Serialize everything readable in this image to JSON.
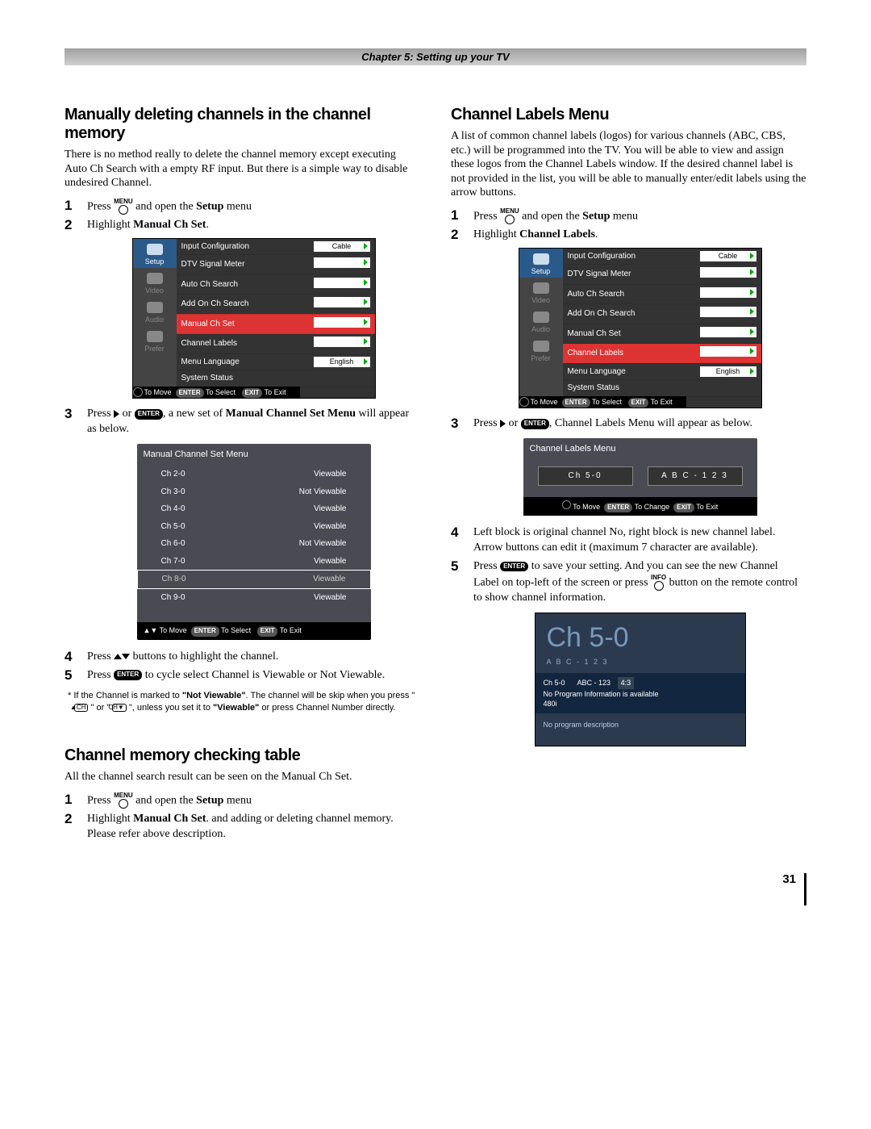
{
  "chapter_bar": "Chapter 5: Setting up your TV",
  "page_number": "31",
  "left": {
    "h1": "Manually deleting channels in the channel memory",
    "intro": "There is no method really to delete the channel memory except executing Auto Ch Search with a empty RF input. But there is a simple way to disable undesired Channel.",
    "step1_a": "Press ",
    "step1_menu": "MENU",
    "step1_b": " and open the ",
    "step1_bold": "Setup",
    "step1_c": " menu",
    "step2_a": "Highlight ",
    "step2_bold": "Manual Ch Set",
    "step2_c": ".",
    "step3_a": "Press ",
    "step3_or": " or ",
    "step3_enter": "ENTER",
    "step3_b": ", a new set of ",
    "step3_bold": "Manual Channel Set Menu",
    "step3_c": " will appear as below.",
    "step4_a": "Press ",
    "step4_b": " buttons to highlight the channel.",
    "step5_a": "Press ",
    "step5_enter": "ENTER",
    "step5_b": " to cycle select Channel is Viewable or Not Viewable.",
    "note_a": "* If the Channel is marked to ",
    "note_bold1": "\"Not Viewable\"",
    "note_b": ". The channel will be skip when you press \" ",
    "note_ch1": "▲CH",
    "note_c": " \" or \" ",
    "note_ch2": "CH▼",
    "note_d": " \", unless you set it to ",
    "note_bold2": "\"Viewable\"",
    "note_e": " or press Channel Number directly.",
    "h2": "Channel memory checking table",
    "p2": "All the channel search result can be seen on the Manual Ch Set.",
    "l2_step1_a": "Press ",
    "l2_step1_menu": "MENU",
    "l2_step1_b": " and open the ",
    "l2_step1_bold": "Setup",
    "l2_step1_c": " menu",
    "l2_step2_a": "Highlight ",
    "l2_step2_bold": "Manual Ch Set",
    "l2_step2_b": ". and adding or deleting channel memory. Please refer above description."
  },
  "right": {
    "h1": "Channel Labels Menu",
    "intro": "A list of common channel labels (logos) for various channels (ABC, CBS, etc.) will be programmed into the TV. You will be able to view and assign these logos from the Channel Labels window. If the desired channel label is not provided in the list, you will be able to manually enter/edit labels using the arrow buttons.",
    "step1_a": "Press ",
    "step1_menu": "MENU",
    "step1_b": " and open the ",
    "step1_bold": "Setup",
    "step1_c": " menu",
    "step2_a": "Highlight ",
    "step2_bold": "Channel Labels",
    "step2_c": ".",
    "step3_a": "Press ",
    "step3_or": " or ",
    "step3_enter": "ENTER",
    "step3_b": ", Channel Labels Menu will appear as below.",
    "step4": "Left block is original channel No, right block is new channel label. Arrow buttons can edit it (maximum 7 character are available).",
    "step5_a": "Press ",
    "step5_enter": "ENTER",
    "step5_b": " to save your setting. And you can see the new Channel Label on top-left of the screen or press ",
    "step5_info": "INFO",
    "step5_c": " button on the remote control to show channel information."
  },
  "osd": {
    "tabs": [
      "Setup",
      "Video",
      "Audio",
      "Prefer"
    ],
    "rows": [
      {
        "label": "Input Configuration",
        "value": "Cable"
      },
      {
        "label": "DTV Signal Meter",
        "value": ""
      },
      {
        "label": "Auto Ch Search",
        "value": ""
      },
      {
        "label": "Add On Ch Search",
        "value": ""
      },
      {
        "label": "Manual Ch Set",
        "value": ""
      },
      {
        "label": "Channel Labels",
        "value": ""
      },
      {
        "label": "Menu Language",
        "value": "English"
      },
      {
        "label": "System Status",
        "value": null
      }
    ],
    "footer_move": "To Move",
    "footer_enter": "ENTER",
    "footer_select": "To Select",
    "footer_exit": "EXIT",
    "footer_toexit": "To Exit"
  },
  "mcs": {
    "title": "Manual Channel Set Menu",
    "rows": [
      {
        "ch": "Ch 2-0",
        "st": "Viewable"
      },
      {
        "ch": "Ch 3-0",
        "st": "Not Viewable"
      },
      {
        "ch": "Ch 4-0",
        "st": "Viewable"
      },
      {
        "ch": "Ch 5-0",
        "st": "Viewable"
      },
      {
        "ch": "Ch 6-0",
        "st": "Not Viewable"
      },
      {
        "ch": "Ch 7-0",
        "st": "Viewable"
      },
      {
        "ch": "Ch 8-0",
        "st": "Viewable"
      },
      {
        "ch": "Ch 9-0",
        "st": "Viewable"
      }
    ],
    "footer_move": "To Move",
    "footer_enter": "ENTER",
    "footer_select": "To Select",
    "footer_exit": "EXIT",
    "footer_toexit": "To Exit"
  },
  "clm": {
    "title": "Channel Labels Menu",
    "ch": "Ch 5-0",
    "label": "A B C - 1 2 3",
    "footer_move": "To Move",
    "footer_enter": "ENTER",
    "footer_change": "To Change",
    "footer_exit": "EXIT",
    "footer_toexit": "To Exit"
  },
  "chinfo": {
    "big": "Ch 5-0",
    "sub": "A B C - 1 2 3",
    "bar_ch": "Ch 5-0",
    "bar_label": "ABC - 123",
    "bar_aspect": "4:3",
    "bar_line2": "No Program Information is available",
    "bar_res": "480i",
    "desc": "No program description"
  }
}
